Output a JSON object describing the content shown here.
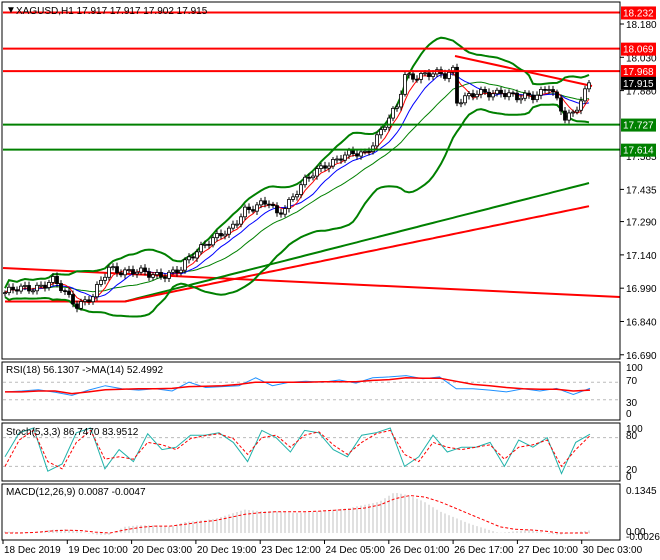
{
  "title": "XAGUSD,H1  17.917 17.917 17.902 17.915",
  "colors": {
    "bull": "#000000",
    "bear": "#000000",
    "level_red": "#ff0000",
    "level_green": "#008000",
    "bb": "#008000",
    "ma_fast": "#ff0000",
    "ma_slow": "#0000ff",
    "rsi": "#1e90ff",
    "signal": "#ff0000",
    "stoch": "#20b2aa",
    "hist": "#c0c0c0"
  },
  "chart_data": {
    "type": "candlestick",
    "symbol": "XAGUSD",
    "timeframe": "H1",
    "ohlc_last": {
      "open": 17.917,
      "high": 17.917,
      "low": 17.902,
      "close": 17.915
    },
    "ylim": [
      16.69,
      18.232
    ],
    "y_ticks": [
      "18.180",
      "18.030",
      "17.880",
      "17.585",
      "17.435",
      "17.290",
      "17.140",
      "16.990",
      "16.840",
      "16.690"
    ],
    "close_anchors": [
      [
        0,
        16.97
      ],
      [
        8,
        17.0
      ],
      [
        12,
        17.02
      ],
      [
        16,
        16.95
      ],
      [
        18,
        16.92
      ],
      [
        22,
        16.95
      ],
      [
        26,
        17.08
      ],
      [
        30,
        17.07
      ],
      [
        36,
        17.05
      ],
      [
        42,
        17.06
      ],
      [
        44,
        17.07
      ],
      [
        46,
        17.12
      ],
      [
        50,
        17.2
      ],
      [
        56,
        17.24
      ],
      [
        60,
        17.35
      ],
      [
        66,
        17.37
      ],
      [
        68,
        17.32
      ],
      [
        74,
        17.45
      ],
      [
        80,
        17.55
      ],
      [
        84,
        17.58
      ],
      [
        90,
        17.6
      ],
      [
        94,
        17.7
      ],
      [
        98,
        17.8
      ],
      [
        100,
        17.95
      ],
      [
        110,
        17.95
      ],
      [
        112,
        17.98
      ],
      [
        113,
        17.84
      ],
      [
        118,
        17.86
      ],
      [
        124,
        17.88
      ],
      [
        128,
        17.84
      ],
      [
        132,
        17.86
      ],
      [
        136,
        17.9
      ],
      [
        140,
        17.75
      ],
      [
        142,
        17.78
      ],
      [
        146,
        17.915
      ]
    ],
    "levels": [
      {
        "price": "18.232",
        "color": "red"
      },
      {
        "price": "18.069",
        "color": "red"
      },
      {
        "price": "17.968",
        "color": "red"
      },
      {
        "price": "17.727",
        "color": "green"
      },
      {
        "price": "17.614",
        "color": "green"
      }
    ],
    "current_price": "17.915",
    "x_labels": [
      "18 Dec 2019",
      "19 Dec 10:00",
      "20 Dec 03:00",
      "20 Dec 19:00",
      "23 Dec 12:00",
      "24 Dec 05:00",
      "26 Dec 01:00",
      "26 Dec 17:00",
      "27 Dec 10:00",
      "30 Dec 03:00"
    ],
    "rsi": {
      "label": "RSI(18) 56.1307  ->MA(14) 52.4992",
      "ticks": [
        "100",
        "70",
        "30",
        "0"
      ],
      "values": [
        48,
        50,
        53,
        47,
        40,
        52,
        62,
        55,
        52,
        55,
        50,
        70,
        58,
        60,
        62,
        80,
        62,
        70,
        72,
        70,
        75,
        68,
        80,
        82,
        85,
        78,
        82,
        55,
        55,
        52,
        48,
        55,
        50,
        56,
        42,
        56
      ],
      "ma": [
        48,
        48,
        50,
        50,
        44,
        48,
        53,
        54,
        55,
        55,
        56,
        60,
        61,
        62,
        65,
        70,
        70,
        70,
        70,
        71,
        71,
        71,
        74,
        76,
        80,
        79,
        79,
        72,
        65,
        62,
        58,
        55,
        54,
        54,
        50,
        52
      ]
    },
    "stoch": {
      "label": "Stoch(5,3,3) 86.7470 83.9512",
      "ticks": [
        "100",
        "80",
        "20",
        "0"
      ],
      "main": [
        40,
        90,
        100,
        10,
        25,
        90,
        100,
        15,
        55,
        30,
        88,
        55,
        60,
        85,
        85,
        90,
        70,
        30,
        95,
        80,
        50,
        95,
        90,
        55,
        40,
        85,
        90,
        100,
        20,
        40,
        85,
        50,
        60,
        60,
        70,
        20,
        75,
        60,
        80,
        5,
        70,
        87
      ],
      "signal": [
        20,
        75,
        95,
        30,
        15,
        70,
        95,
        35,
        40,
        35,
        70,
        65,
        55,
        78,
        84,
        88,
        78,
        45,
        80,
        85,
        60,
        85,
        92,
        65,
        45,
        70,
        88,
        95,
        45,
        30,
        70,
        60,
        55,
        60,
        65,
        35,
        60,
        65,
        75,
        20,
        55,
        84
      ]
    },
    "macd": {
      "label": "MACD(12,26,9) 0.0087 -0.0047",
      "ticks": [
        "0.1345",
        "0.00",
        "-0.0026"
      ],
      "hist": [
        0.005,
        0.003,
        0.0,
        0.01,
        0.012,
        0.005,
        -0.005,
        -0.006,
        0.02,
        0.025,
        0.025,
        0.02,
        0.035,
        0.04,
        0.045,
        0.06,
        0.075,
        0.07,
        0.07,
        0.065,
        0.065,
        0.07,
        0.075,
        0.08,
        0.09,
        0.1,
        0.13,
        0.12,
        0.1,
        0.07,
        0.05,
        0.03,
        0.015,
        0.0,
        0.005,
        0.01,
        0.0,
        -0.006,
        0.002,
        0.008
      ],
      "signal": [
        0.0,
        0.0,
        0.002,
        0.006,
        0.009,
        0.008,
        0.003,
        0.0,
        0.01,
        0.018,
        0.022,
        0.022,
        0.028,
        0.035,
        0.04,
        0.05,
        0.06,
        0.065,
        0.068,
        0.068,
        0.068,
        0.07,
        0.073,
        0.076,
        0.08,
        0.09,
        0.11,
        0.12,
        0.115,
        0.1,
        0.08,
        0.06,
        0.04,
        0.02,
        0.012,
        0.01,
        0.006,
        0.0,
        0.0,
        0.0
      ]
    }
  }
}
